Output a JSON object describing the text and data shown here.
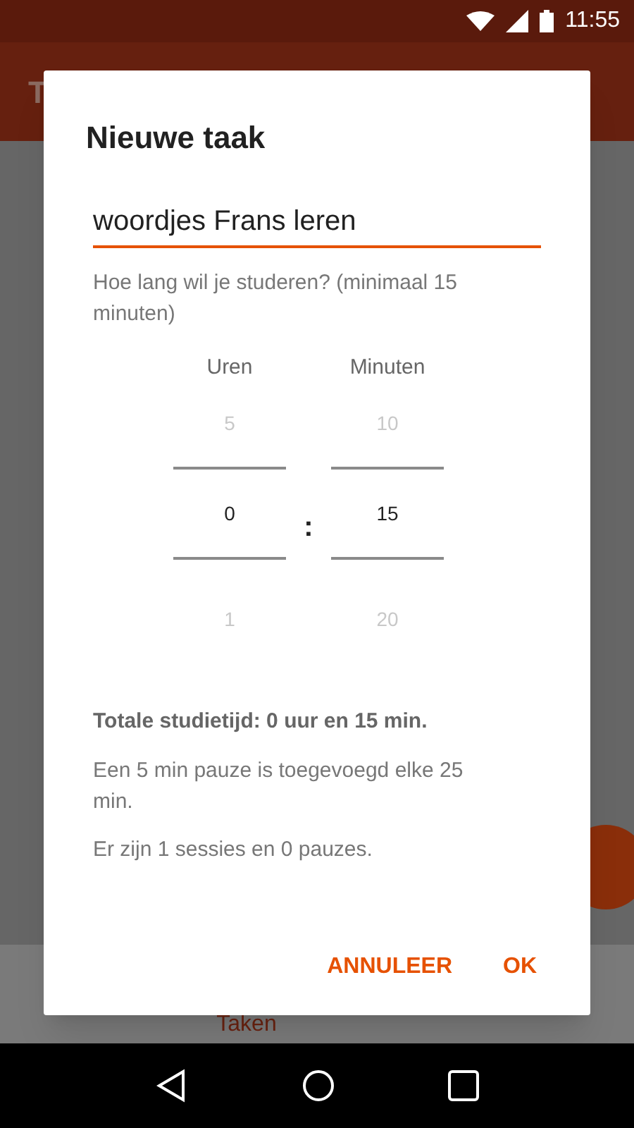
{
  "status_bar": {
    "time": "11:55"
  },
  "app_bar": {
    "title": "T"
  },
  "bottom_nav": {
    "label": "Taken"
  },
  "dialog": {
    "title": "Nieuwe taak",
    "task_field": {
      "value": "woordjes Frans leren"
    },
    "prompt": "Hoe lang wil je studeren? (minimaal 15 minuten)",
    "pickers": [
      {
        "label": "Uren",
        "above": "5",
        "value": "0",
        "below": "1"
      },
      {
        "label": "Minuten",
        "above": "10",
        "value": "15",
        "below": "20"
      }
    ],
    "separator": ":",
    "summary": "Totale studietijd: 0 uur en 15 min.",
    "notes": [
      "Een 5 min pauze is toegevoegd elke 25 min.",
      "Er zijn 1 sessies en 0 pauzes."
    ],
    "buttons": [
      "ANNULEER",
      "OK"
    ]
  }
}
